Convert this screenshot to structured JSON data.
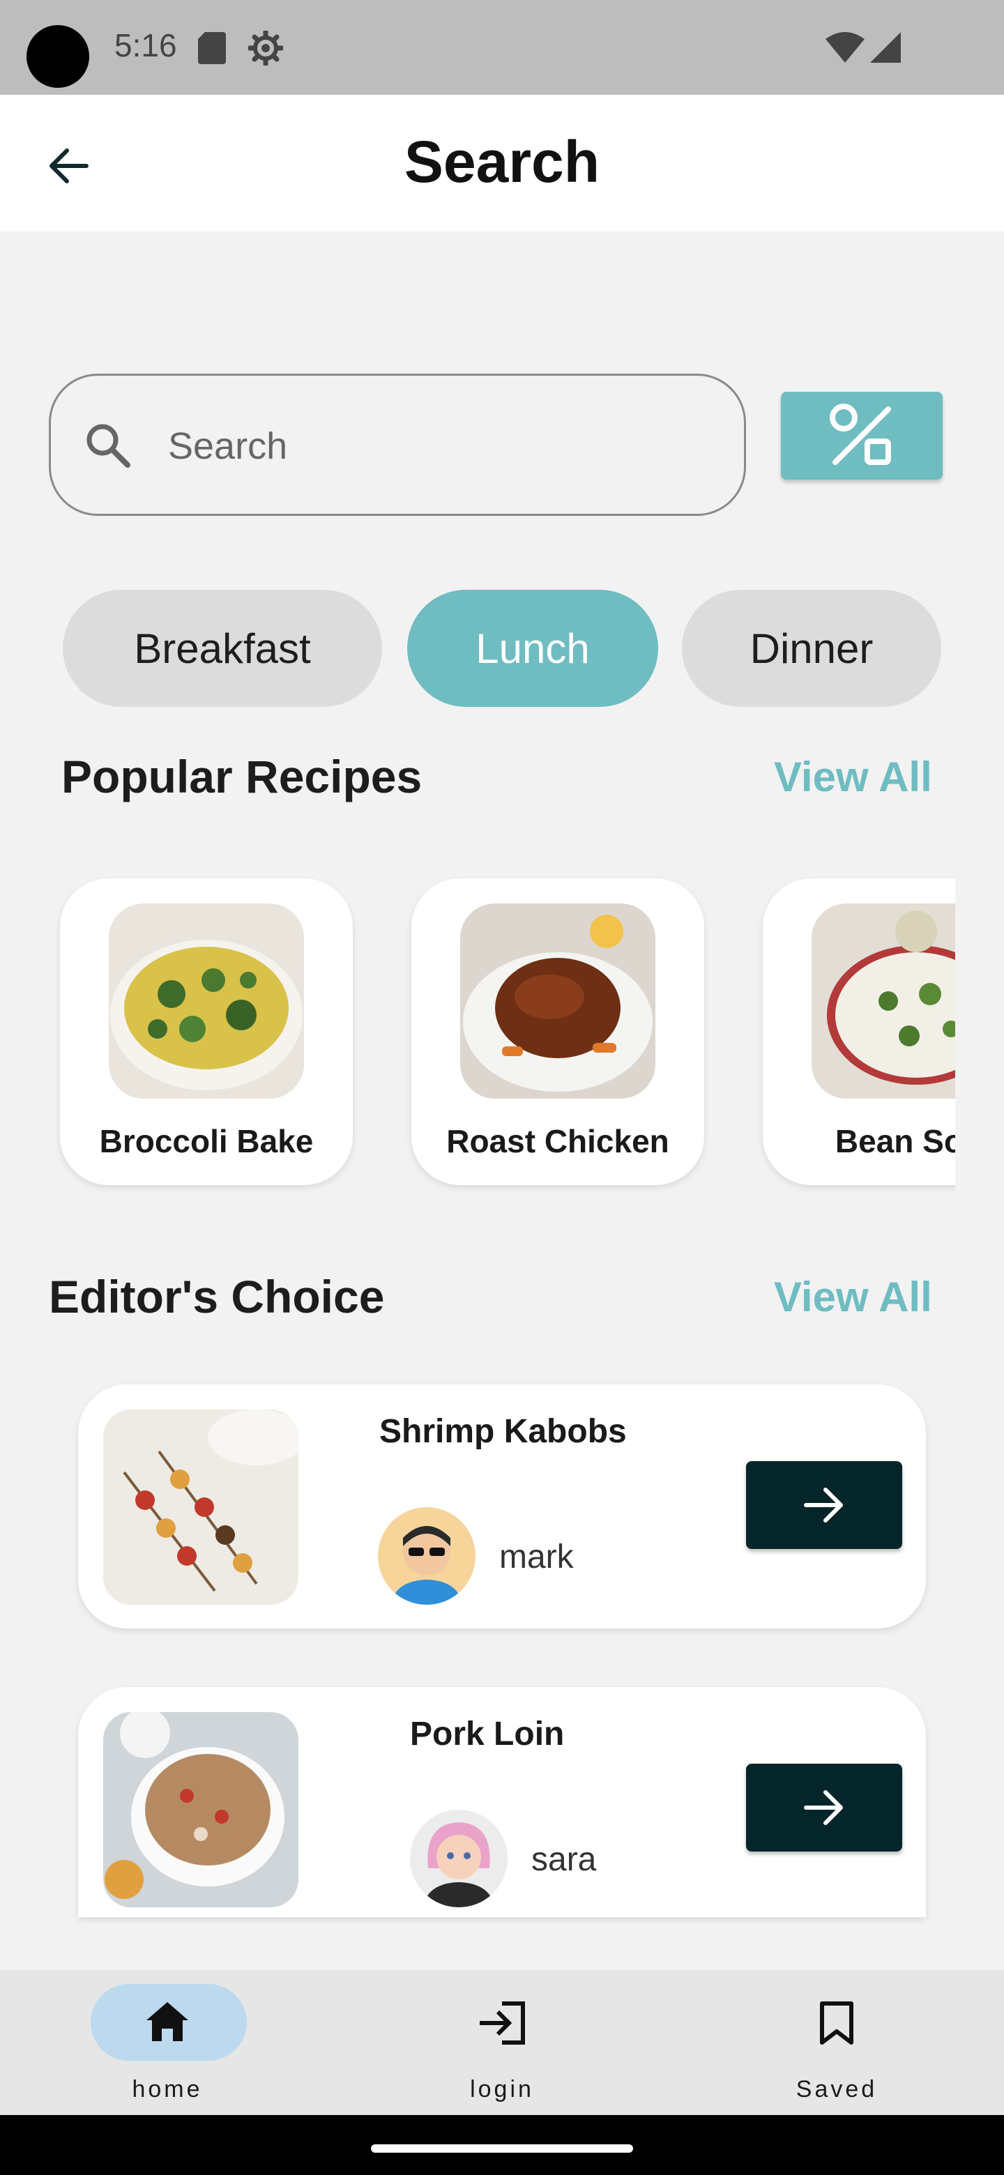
{
  "status_bar": {
    "time": "5:16"
  },
  "app_bar": {
    "title": "Search"
  },
  "search": {
    "placeholder": "Search"
  },
  "categories": [
    {
      "label": "Breakfast",
      "selected": false
    },
    {
      "label": "Lunch",
      "selected": true
    },
    {
      "label": "Dinner",
      "selected": false
    }
  ],
  "popular": {
    "title": "Popular Recipes",
    "view_all": "View All",
    "items": [
      {
        "name": "Broccoli Bake"
      },
      {
        "name": "Roast Chicken"
      },
      {
        "name": "Bean Sou"
      }
    ]
  },
  "editors_choice": {
    "title": "Editor's Choice",
    "view_all": "View All",
    "items": [
      {
        "title": "Shrimp Kabobs",
        "author": "mark"
      },
      {
        "title": "Pork Loin",
        "author": "sara"
      }
    ]
  },
  "bottom_nav": {
    "items": [
      {
        "label": "home",
        "icon": "home-icon",
        "active": true
      },
      {
        "label": "login",
        "icon": "login-icon",
        "active": false
      },
      {
        "label": "Saved",
        "icon": "bookmark-icon",
        "active": false
      }
    ]
  },
  "colors": {
    "accent": "#6fbcc1",
    "dark_button": "#04262a",
    "nav_active_pill": "#bcd9ee",
    "chip_inactive": "#dcdcdc"
  }
}
